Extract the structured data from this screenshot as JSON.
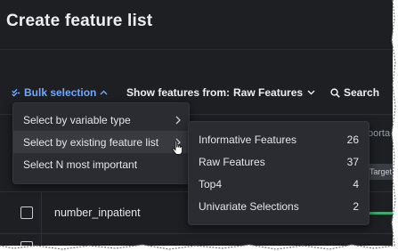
{
  "page": {
    "title": "Create feature list"
  },
  "toolbar": {
    "bulk_label": "Bulk selection",
    "show_prefix": "Show features from:",
    "show_value": "Raw Features",
    "search_label": "Search"
  },
  "table": {
    "partial_header": "porta",
    "partial_chip": "Target",
    "rows": [
      {
        "name": "number_inpatient"
      }
    ]
  },
  "bulk_menu": {
    "items": [
      {
        "label": "Select by variable type",
        "has_submenu": true
      },
      {
        "label": "Select by existing feature list",
        "has_submenu": true
      },
      {
        "label": "Select N most important",
        "has_submenu": false
      }
    ]
  },
  "feature_list_menu": {
    "items": [
      {
        "label": "Informative Features",
        "count": "26"
      },
      {
        "label": "Raw Features",
        "count": "37"
      },
      {
        "label": "Top4",
        "count": "4"
      },
      {
        "label": "Univariate Selections",
        "count": "2"
      }
    ]
  },
  "colors": {
    "background": "#1e1f23",
    "menu": "#2a2c31",
    "accent": "#6ea8ff",
    "text": "#eceef2",
    "bar": "#3fa86a"
  }
}
